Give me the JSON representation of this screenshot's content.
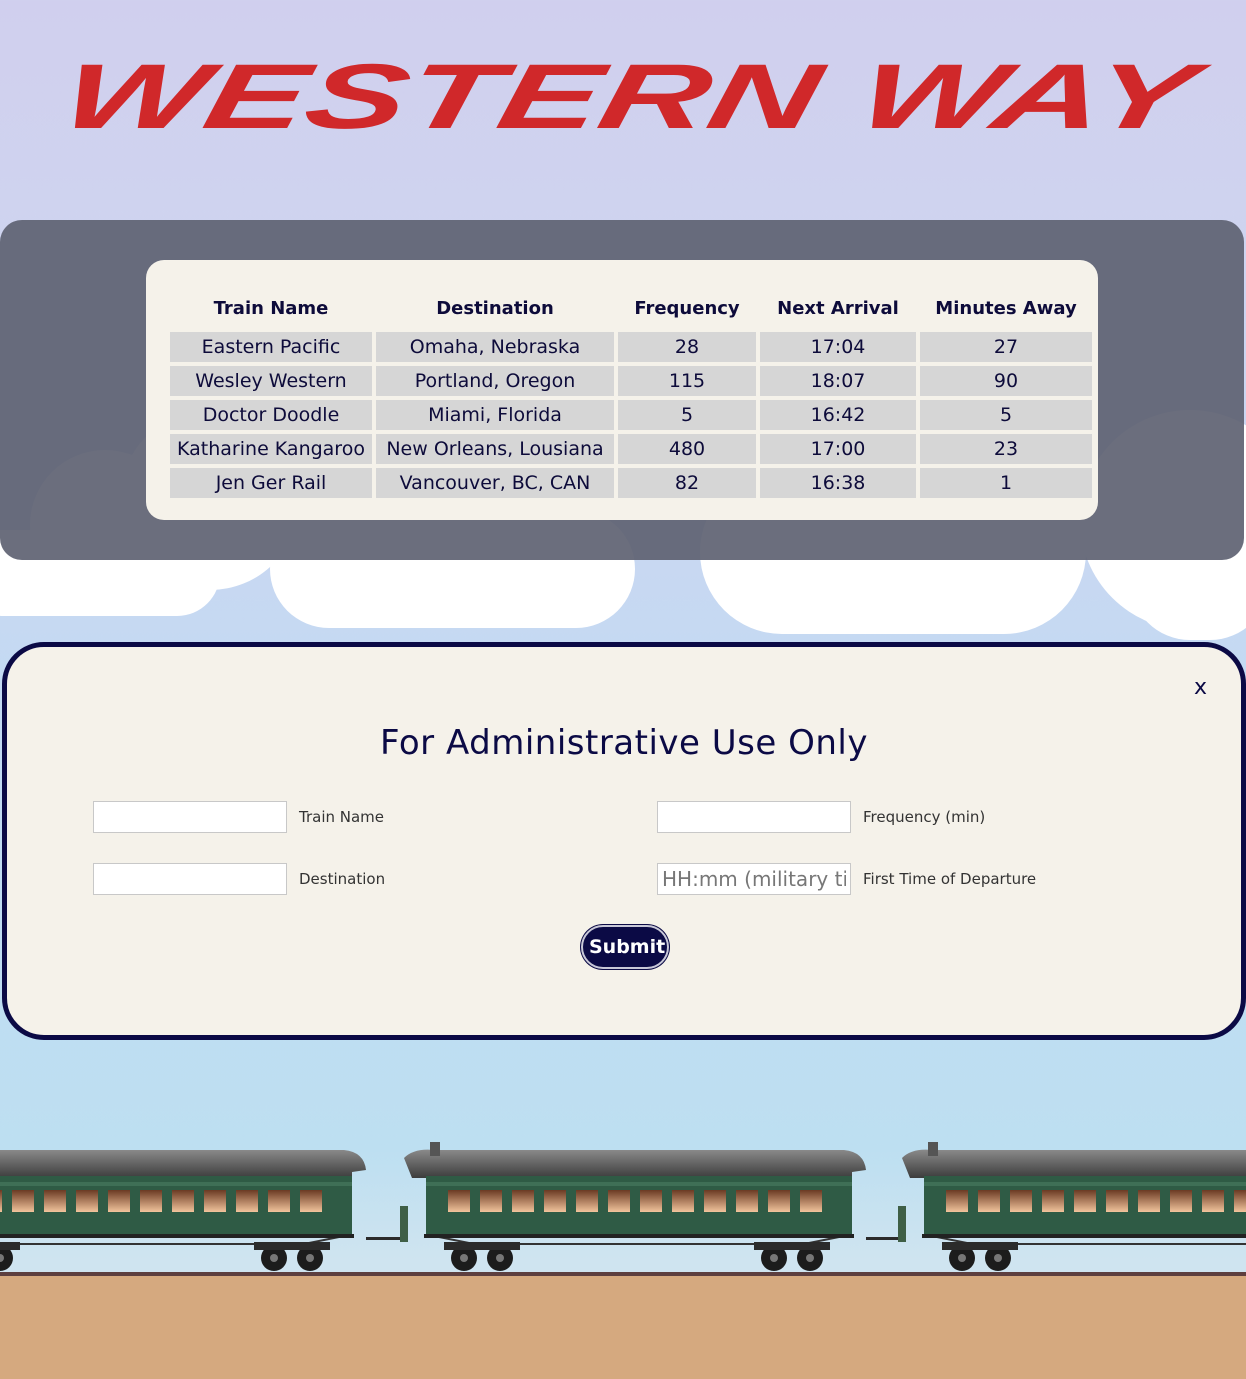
{
  "header": {
    "title": "WESTERN WAY"
  },
  "schedule": {
    "columns": [
      "Train Name",
      "Destination",
      "Frequency",
      "Next Arrival",
      "Minutes Away"
    ],
    "rows": [
      [
        "Eastern Pacific",
        "Omaha, Nebraska",
        "28",
        "17:04",
        "27"
      ],
      [
        "Wesley Western",
        "Portland, Oregon",
        "115",
        "18:07",
        "90"
      ],
      [
        "Doctor Doodle",
        "Miami, Florida",
        "5",
        "16:42",
        "5"
      ],
      [
        "Katharine Kangaroo",
        "New Orleans, Lousiana",
        "480",
        "17:00",
        "23"
      ],
      [
        "Jen Ger Rail",
        "Vancouver, BC, CAN",
        "82",
        "16:38",
        "1"
      ]
    ]
  },
  "admin": {
    "close_label": "x",
    "title": "For Administrative Use Only",
    "train_name_label": "Train Name",
    "destination_label": "Destination",
    "frequency_label": "Frequency (min)",
    "first_departure_label": "First Time of Departure",
    "first_departure_placeholder": "HH:mm (military time)",
    "submit_label": "Submit"
  },
  "colors": {
    "title": "#d0282a",
    "navy": "#0b0a45",
    "band": "#5e6272",
    "card": "#f5f2ea",
    "train_body": "#2f5b45",
    "ground": "#d5a97f"
  }
}
